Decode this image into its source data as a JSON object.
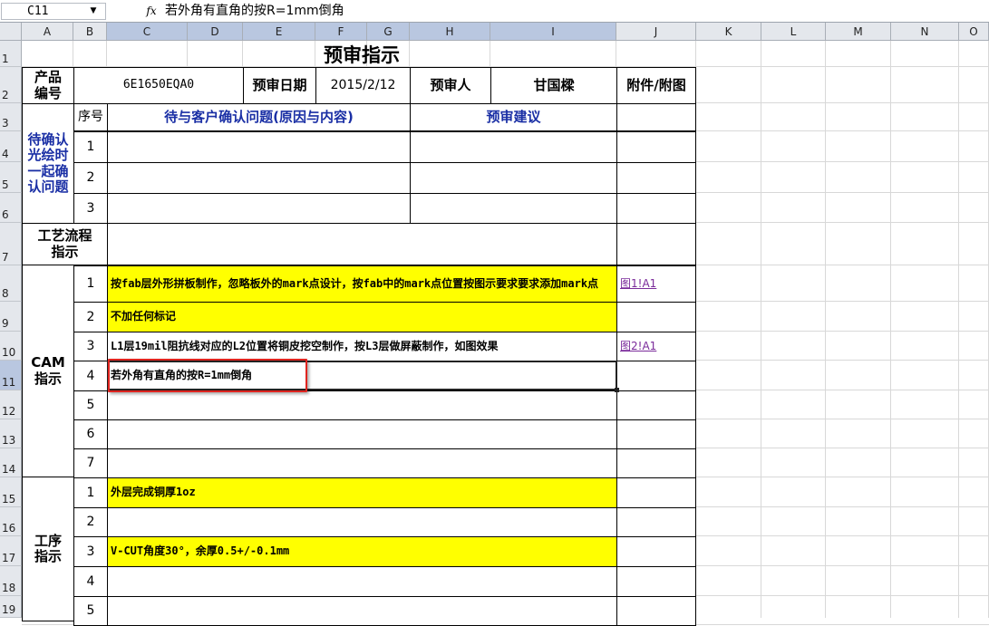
{
  "formula_bar": {
    "name_box": "C11",
    "fx_label": "fx",
    "formula": "若外角有直角的按R=1mm倒角"
  },
  "columns": [
    "A",
    "B",
    "C",
    "D",
    "E",
    "F",
    "G",
    "H",
    "I",
    "J",
    "K",
    "L",
    "M",
    "N",
    "O"
  ],
  "rows": [
    "1",
    "2",
    "3",
    "4",
    "5",
    "6",
    "7",
    "8",
    "9",
    "10",
    "11",
    "12",
    "13",
    "14",
    "15",
    "16",
    "17",
    "18",
    "19"
  ],
  "sheet": {
    "title": "预审指示",
    "product_label": "产品\n编号",
    "product_value": "6E1650EQA0",
    "date_label": "预审日期",
    "date_value": "2015/2/12",
    "reviewer_label": "预审人",
    "reviewer_value": "甘国樑",
    "attach_label": "附件/附图",
    "seq_label": "序号",
    "confirm_header": "待与客户确认问题(原因与内容)",
    "suggest_header": "预审建议",
    "confirm_section": "待确认\n光绘时\n一起确\n认问题",
    "confirm_rows": [
      "1",
      "2",
      "3"
    ],
    "process_section": "工艺流程\n指示",
    "cam_section": "CAM\n指示",
    "cam_rows": [
      {
        "n": "1",
        "text": "按fab层外形拼板制作，忽略板外的mark点设计，按fab中的mark点位置按图示要求要求添加mark点",
        "link": "图1!A1"
      },
      {
        "n": "2",
        "text": "不加任何标记",
        "link": ""
      },
      {
        "n": "3",
        "text": "L1层19mil阻抗线对应的L2位置将铜皮挖空制作，按L3层做屏蔽制作，如图效果",
        "link": "图2!A1"
      },
      {
        "n": "4",
        "text": "若外角有直角的按R=1mm倒角",
        "link": ""
      },
      {
        "n": "5",
        "text": "",
        "link": ""
      },
      {
        "n": "6",
        "text": "",
        "link": ""
      },
      {
        "n": "7",
        "text": "",
        "link": ""
      }
    ],
    "proc_section": "工序\n指示",
    "proc_rows": [
      {
        "n": "1",
        "text": "外层完成铜厚1oz"
      },
      {
        "n": "2",
        "text": ""
      },
      {
        "n": "3",
        "text": "V-CUT角度30°，余厚0.5+/-0.1mm"
      },
      {
        "n": "4",
        "text": ""
      },
      {
        "n": "5",
        "text": ""
      }
    ]
  },
  "colors": {
    "highlight": "#ffff00",
    "header_blue": "#1a2fa5",
    "selection_box": "#e0241f",
    "link": "#7a2a9a"
  }
}
